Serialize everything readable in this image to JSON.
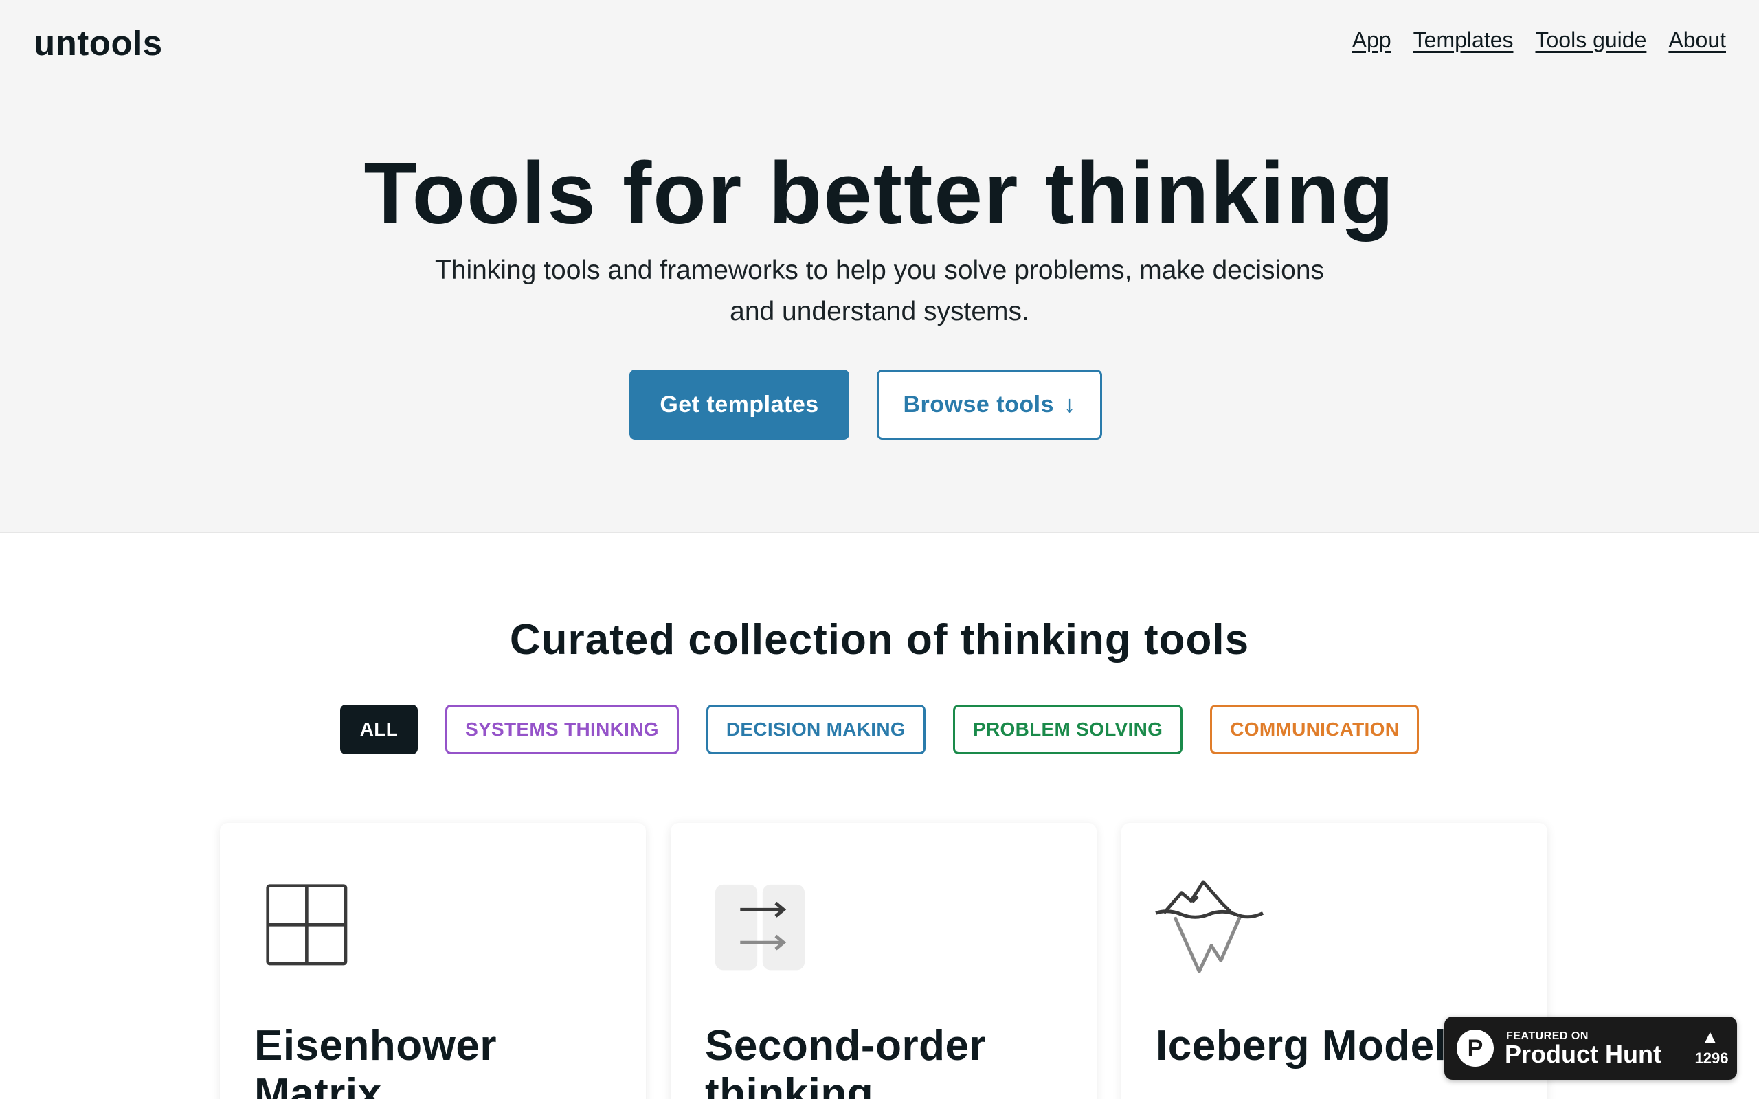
{
  "header": {
    "logo": "untools",
    "nav": [
      {
        "label": "App"
      },
      {
        "label": "Templates"
      },
      {
        "label": "Tools guide"
      },
      {
        "label": "About"
      }
    ]
  },
  "hero": {
    "title": "Tools for better thinking",
    "subtitle_line1": "Thinking tools and frameworks to help you solve problems, make decisions",
    "subtitle_line2": "and understand systems.",
    "primary_button": "Get templates",
    "secondary_button": "Browse tools",
    "secondary_button_icon": "↓"
  },
  "collection": {
    "title": "Curated collection of thinking tools",
    "filters": [
      {
        "label": "ALL",
        "color": "#0f1a1f"
      },
      {
        "label": "SYSTEMS THINKING",
        "color": "#9553c9"
      },
      {
        "label": "DECISION MAKING",
        "color": "#2a7bab"
      },
      {
        "label": "PROBLEM SOLVING",
        "color": "#1a8a4a"
      },
      {
        "label": "COMMUNICATION",
        "color": "#e07d2a"
      }
    ],
    "cards": [
      {
        "title_line1": "Eisenhower",
        "title_line2": "Matrix",
        "icon": "grid-icon"
      },
      {
        "title_line1": "Second-order",
        "title_line2": "thinking",
        "icon": "arrows-icon"
      },
      {
        "title_line1": "Iceberg Model",
        "title_line2": "",
        "icon": "iceberg-icon"
      }
    ]
  },
  "product_hunt": {
    "featured": "FEATURED ON",
    "name": "Product Hunt",
    "logo_letter": "P",
    "arrow": "▲",
    "count": "1296"
  },
  "colors": {
    "accent": "#2a7bab",
    "hero_bg": "#f5f5f5",
    "text": "#0f1a1f"
  }
}
